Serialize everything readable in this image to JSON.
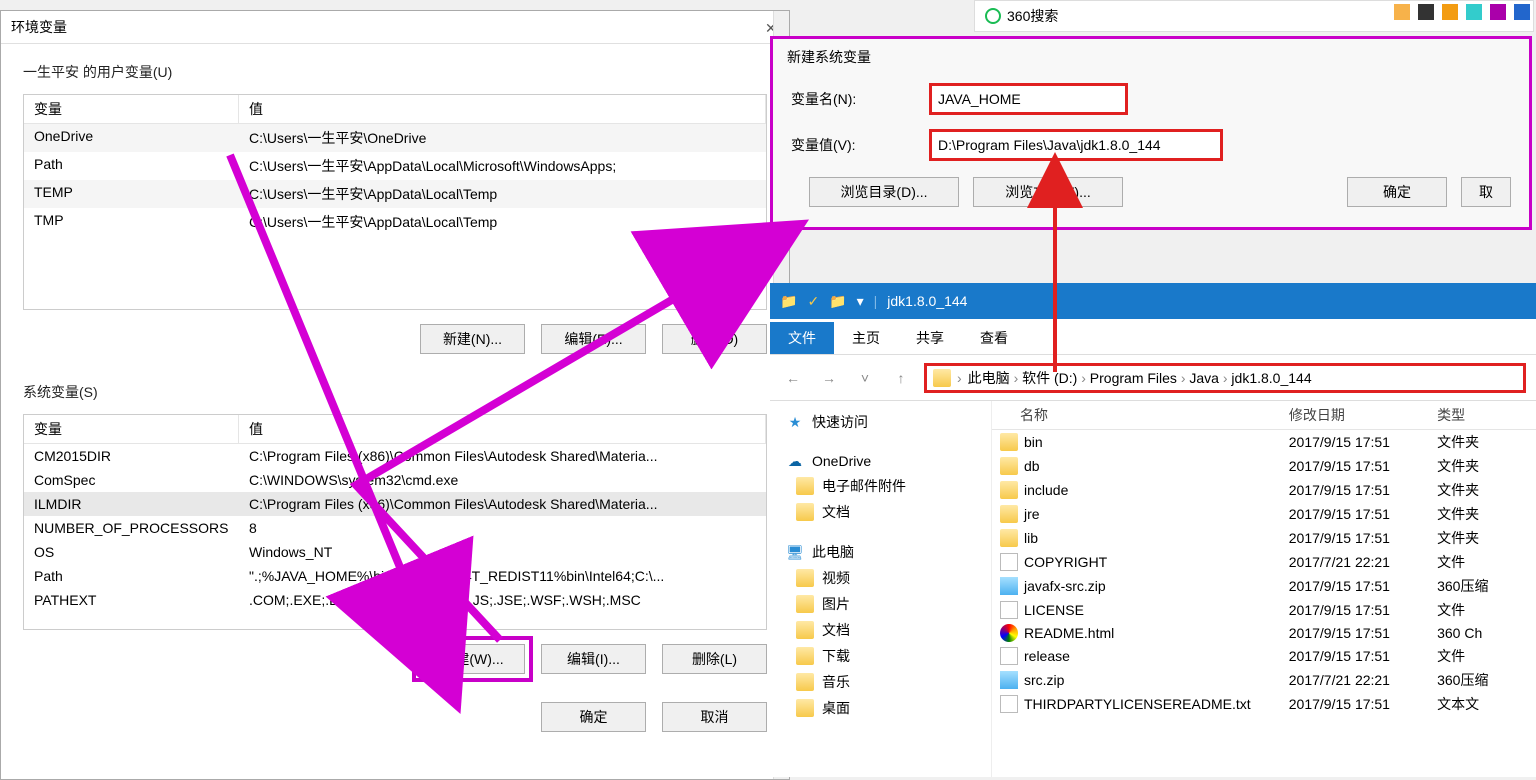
{
  "env_dialog": {
    "title": "环境变量",
    "user_group_label": "一生平安 的用户变量(U)",
    "sys_group_label": "系统变量(S)",
    "headers": {
      "var": "变量",
      "val": "值"
    },
    "user_vars": [
      {
        "var": "OneDrive",
        "val": "C:\\Users\\一生平安\\OneDrive"
      },
      {
        "var": "Path",
        "val": "C:\\Users\\一生平安\\AppData\\Local\\Microsoft\\WindowsApps;"
      },
      {
        "var": "TEMP",
        "val": "C:\\Users\\一生平安\\AppData\\Local\\Temp"
      },
      {
        "var": "TMP",
        "val": "C:\\Users\\一生平安\\AppData\\Local\\Temp"
      }
    ],
    "sys_vars": [
      {
        "var": "CM2015DIR",
        "val": "C:\\Program Files (x86)\\Common Files\\Autodesk Shared\\Materia..."
      },
      {
        "var": "ComSpec",
        "val": "C:\\WINDOWS\\system32\\cmd.exe"
      },
      {
        "var": "ILMDIR",
        "val": "C:\\Program Files (x86)\\Common Files\\Autodesk Shared\\Materia..."
      },
      {
        "var": "NUMBER_OF_PROCESSORS",
        "val": "8"
      },
      {
        "var": "OS",
        "val": "Windows_NT"
      },
      {
        "var": "Path",
        "val": "\".;%JAVA_HOME%\\bin;\";%C_EM64T_REDIST11%bin\\Intel64;C:\\..."
      },
      {
        "var": "PATHEXT",
        "val": ".COM;.EXE;.BAT;.CMD;.VBS;.VBE;.JS;.JSE;.WSF;.WSH;.MSC"
      }
    ],
    "buttons": {
      "new_user": "新建(N)...",
      "edit_user": "编辑(E)...",
      "del_user": "删除(D)",
      "new_sys": "新建(W)...",
      "edit_sys": "编辑(I)...",
      "del_sys": "删除(L)",
      "ok": "确定",
      "cancel": "取消"
    }
  },
  "newvar_dialog": {
    "title": "新建系统变量",
    "name_label": "变量名(N):",
    "value_label": "变量值(V):",
    "name_value": "JAVA_HOME",
    "value_value": "D:\\Program Files\\Java\\jdk1.8.0_144",
    "buttons": {
      "browse_dir": "浏览目录(D)...",
      "browse_file": "浏览文件(F)...",
      "ok": "确定",
      "cancel": "取"
    }
  },
  "browser_tab": {
    "label": "360搜索"
  },
  "explorer": {
    "title_path": "jdk1.8.0_144",
    "title_sep": "|",
    "ribbon": {
      "file": "文件",
      "home": "主页",
      "share": "共享",
      "view": "查看"
    },
    "breadcrumb": [
      "此电脑",
      "软件 (D:)",
      "Program Files",
      "Java",
      "jdk1.8.0_144"
    ],
    "side": {
      "quick": "快速访问",
      "onedrive": "OneDrive",
      "onedrive_children": [
        "电子邮件附件",
        "文档"
      ],
      "thispc": "此电脑",
      "thispc_children": [
        "视频",
        "图片",
        "文档",
        "下载",
        "音乐",
        "桌面"
      ]
    },
    "cols": {
      "name": "名称",
      "date": "修改日期",
      "type": "类型"
    },
    "files": [
      {
        "icon": "folder",
        "name": "bin",
        "date": "2017/9/15 17:51",
        "type": "文件夹"
      },
      {
        "icon": "folder",
        "name": "db",
        "date": "2017/9/15 17:51",
        "type": "文件夹"
      },
      {
        "icon": "folder",
        "name": "include",
        "date": "2017/9/15 17:51",
        "type": "文件夹"
      },
      {
        "icon": "folder",
        "name": "jre",
        "date": "2017/9/15 17:51",
        "type": "文件夹"
      },
      {
        "icon": "folder",
        "name": "lib",
        "date": "2017/9/15 17:51",
        "type": "文件夹"
      },
      {
        "icon": "file",
        "name": "COPYRIGHT",
        "date": "2017/7/21 22:21",
        "type": "文件"
      },
      {
        "icon": "zip",
        "name": "javafx-src.zip",
        "date": "2017/9/15 17:51",
        "type": "360压缩"
      },
      {
        "icon": "file",
        "name": "LICENSE",
        "date": "2017/9/15 17:51",
        "type": "文件"
      },
      {
        "icon": "html",
        "name": "README.html",
        "date": "2017/9/15 17:51",
        "type": "360 Ch"
      },
      {
        "icon": "file",
        "name": "release",
        "date": "2017/9/15 17:51",
        "type": "文件"
      },
      {
        "icon": "zip",
        "name": "src.zip",
        "date": "2017/7/21 22:21",
        "type": "360压缩"
      },
      {
        "icon": "file",
        "name": "THIRDPARTYLICENSEREADME.txt",
        "date": "2017/9/15 17:51",
        "type": "文本文"
      }
    ]
  }
}
